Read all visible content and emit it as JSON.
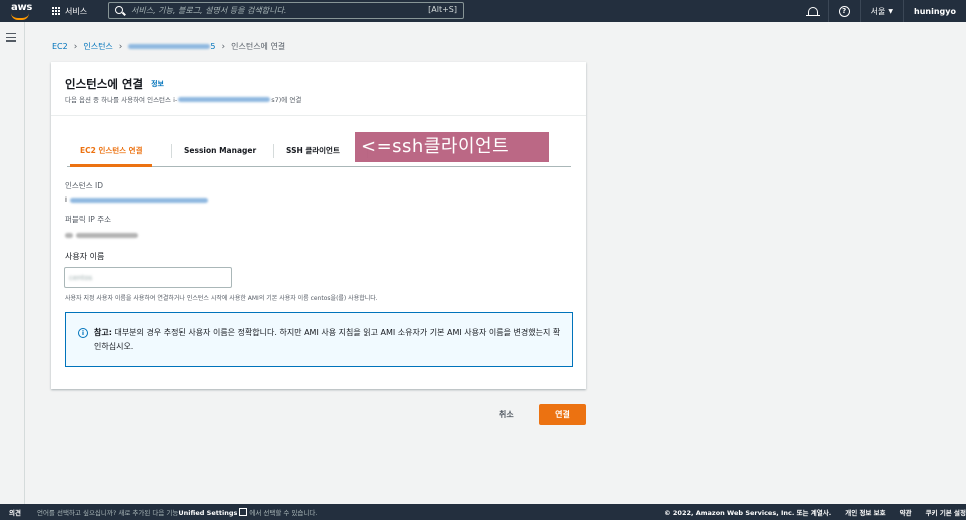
{
  "topnav": {
    "logo": "aws",
    "services_label": "서비스",
    "search_placeholder": "서비스, 기능, 블로그, 설명서 등을 검색합니다.",
    "search_shortcut": "[Alt+S]",
    "region": "서울",
    "account": "huningyo"
  },
  "breadcrumb": {
    "items": [
      "EC2",
      "인스턴스",
      "인스턴스에 연결"
    ],
    "instance_id_suffix": "5"
  },
  "card": {
    "title": "인스턴스에 연결",
    "info_link": "정보",
    "desc_prefix": "다음 옵션 중 하나를 사용하여 인스턴스 i-",
    "desc_suffix": "s7)에 연결"
  },
  "tabs": [
    {
      "label": "EC2 인스턴스 연결",
      "active": true
    },
    {
      "label": "Session Manager",
      "active": false
    },
    {
      "label": "SSH 클라이언트",
      "active": false
    }
  ],
  "annotation": "<=ssh클라이언트",
  "fields": {
    "instance_id_label": "인스턴스 ID",
    "instance_id_prefix": "i",
    "public_ip_label": "퍼블릭 IP 주소",
    "username_label": "사용자 이름",
    "username_value": "centos",
    "username_hint": "사용자 지정 사용자 이름을 사용하여 연결하거나 인스턴스 시작에 사용한 AMI의 기본 사용자 이름 centos을(를) 사용합니다."
  },
  "infobox": {
    "icon": "info-icon",
    "bold": "참고:",
    "text": " 대부분의 경우 추정된 사용자 이름은 정확합니다. 하지만 AMI 사용 지침을 읽고 AMI 소유자가 기본 AMI 사용자 이름을 변경했는지 확인하십시오."
  },
  "buttons": {
    "cancel": "취소",
    "connect": "연결"
  },
  "footer": {
    "feedback": "의견",
    "lang_prefix": "언어를 선택하고 싶으십니까? 새로 추가된 다음 기능",
    "lang_link": "Unified Settings",
    "lang_suffix": "에서 선택할 수 있습니다.",
    "copyright": "© 2022, Amazon Web Services, Inc. 또는 계열사.",
    "privacy": "개인 정보 보호",
    "terms": "약관",
    "cookies": "쿠키 기본 설정"
  },
  "colors": {
    "nav_bg": "#232f3e",
    "accent_orange": "#ec7211",
    "link_blue": "#0073bb",
    "annotation_bg": "#b8607f"
  }
}
